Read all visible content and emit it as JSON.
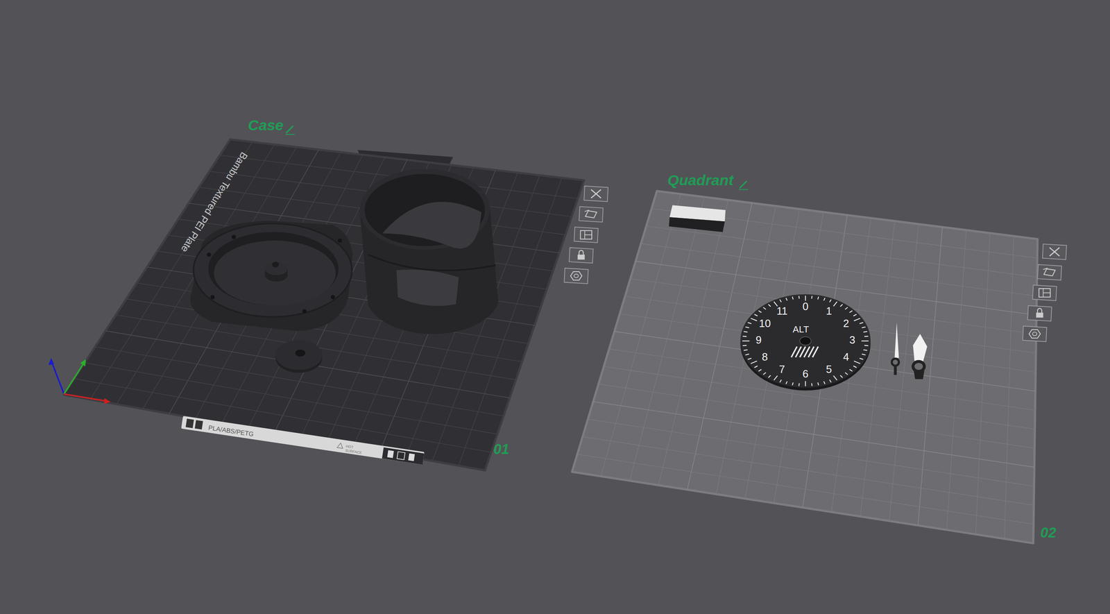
{
  "plates": [
    {
      "name": "Case",
      "number": "01",
      "selected": true,
      "bed_label": "Bambu Textured PEI Plate",
      "strip_text": "PLA/ABS/PETG",
      "warning": [
        "HOT",
        "SURFACE"
      ]
    },
    {
      "name": "Quadrant",
      "number": "02",
      "selected": false
    }
  ],
  "dial": {
    "label": "ALT",
    "numbers": [
      "0",
      "1",
      "2",
      "3",
      "4",
      "5",
      "6",
      "7",
      "8",
      "9",
      "10",
      "11"
    ]
  }
}
